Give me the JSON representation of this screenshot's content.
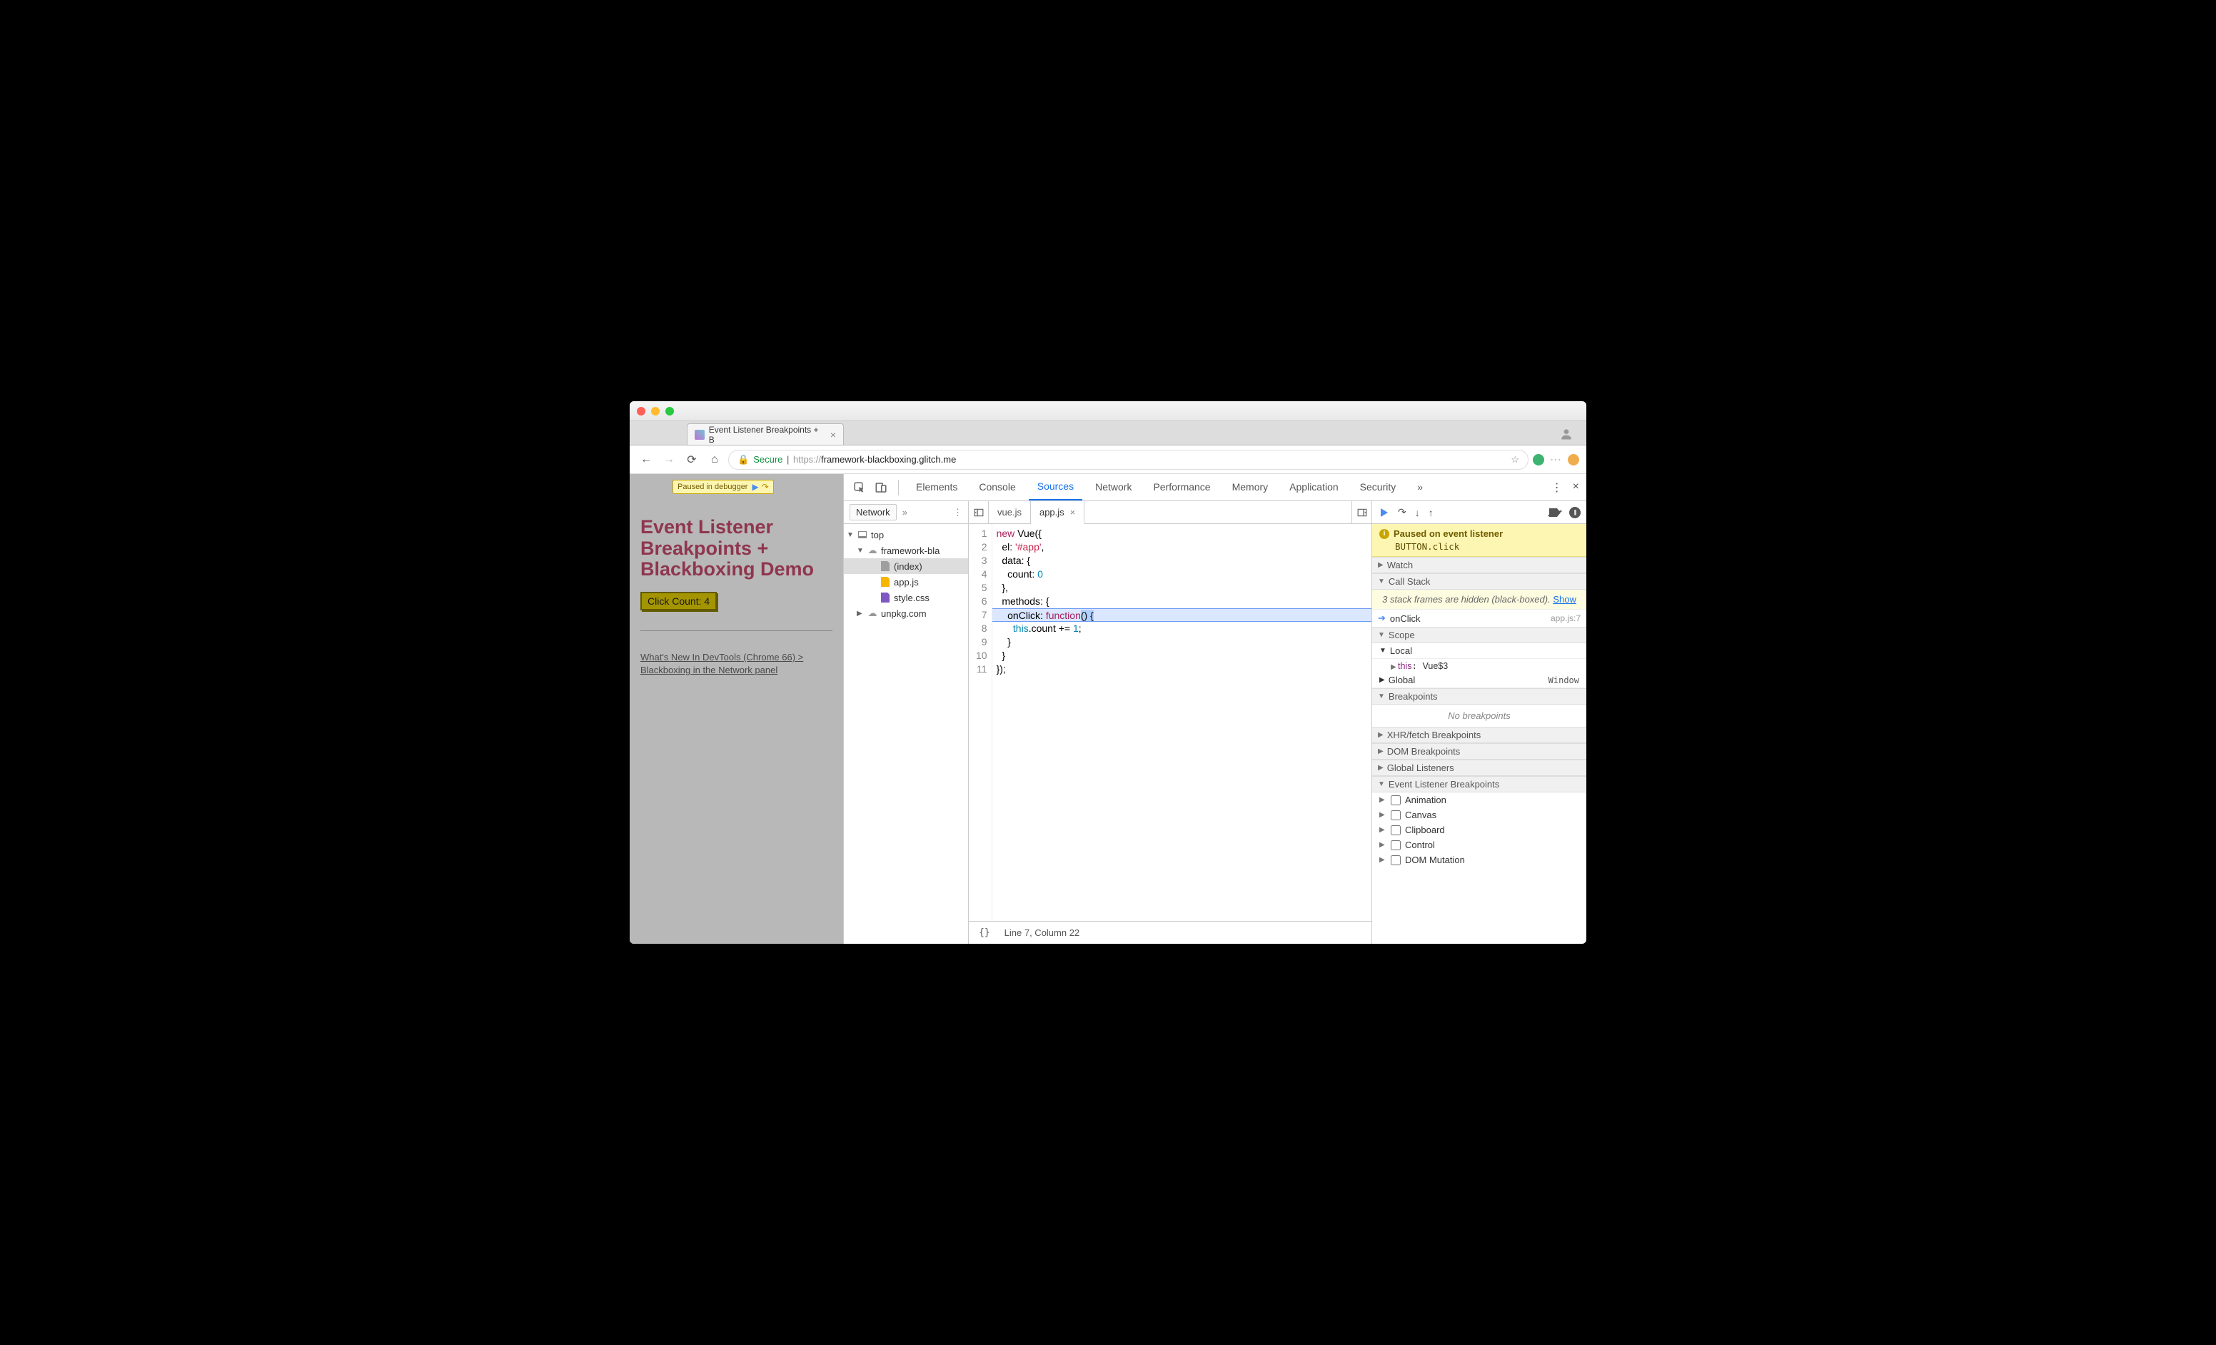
{
  "window": {},
  "browser_tab": {
    "title": "Event Listener Breakpoints + B",
    "close_x": "×"
  },
  "addr": {
    "secure_label": "Secure",
    "proto": "https://",
    "host": "framework-blackboxing.glitch.me",
    "path": ""
  },
  "page": {
    "paused_label": "Paused in debugger",
    "heading": "Event Listener Breakpoints + Blackboxing Demo",
    "button_label": "Click Count: 4",
    "link_text": "What's New In DevTools (Chrome 66) > Blackboxing in the Network panel"
  },
  "devtools": {
    "tabs": [
      "Elements",
      "Console",
      "Sources",
      "Network",
      "Performance",
      "Memory",
      "Application",
      "Security"
    ],
    "active_tab": "Sources",
    "more_icon": "»",
    "kebab": "⋮",
    "close": "×"
  },
  "filetree": {
    "tab": "Network",
    "more": "»",
    "nodes": [
      {
        "depth": 1,
        "caret": "▼",
        "icon": "frame",
        "label": "top"
      },
      {
        "depth": 2,
        "caret": "▼",
        "icon": "cloud",
        "label": "framework-bla"
      },
      {
        "depth": 3,
        "caret": "",
        "icon": "file-gray",
        "label": "(index)",
        "selected": true
      },
      {
        "depth": 3,
        "caret": "",
        "icon": "file-yellow",
        "label": "app.js"
      },
      {
        "depth": 3,
        "caret": "",
        "icon": "file-purple",
        "label": "style.css"
      },
      {
        "depth": 2,
        "caret": "▶",
        "icon": "cloud",
        "label": "unpkg.com"
      }
    ]
  },
  "editor": {
    "open_tabs": [
      {
        "name": "vue.js",
        "active": false
      },
      {
        "name": "app.js",
        "active": true
      }
    ],
    "lines": [
      {
        "n": 1,
        "html": "<span class='tok-kw'>new</span> Vue({"
      },
      {
        "n": 2,
        "html": "  el: <span class='tok-str'>'#app'</span>,"
      },
      {
        "n": 3,
        "html": "  data: {"
      },
      {
        "n": 4,
        "html": "    count: <span class='tok-num'>0</span>"
      },
      {
        "n": 5,
        "html": "  },"
      },
      {
        "n": 6,
        "html": "  methods: {"
      },
      {
        "n": 7,
        "html": "    onClick: <span class='tok-kw'>function</span><span class='exec-mark'>() {</span>",
        "exec": true
      },
      {
        "n": 8,
        "html": "      <span class='tok-this'>this</span>.count += <span class='tok-num'>1</span>;"
      },
      {
        "n": 9,
        "html": "    }"
      },
      {
        "n": 10,
        "html": "  }"
      },
      {
        "n": 11,
        "html": "});"
      }
    ],
    "status": "Line 7, Column 22"
  },
  "debugger": {
    "banner_title": "Paused on event listener",
    "banner_detail": "BUTTON.click",
    "sections": {
      "watch": "Watch",
      "callstack": "Call Stack",
      "scope": "Scope",
      "breakpoints": "Breakpoints",
      "xhr": "XHR/fetch Breakpoints",
      "dom": "DOM Breakpoints",
      "global": "Global Listeners",
      "elb": "Event Listener Breakpoints"
    },
    "blackbox_note_prefix": "3 stack frames are hidden (black-boxed).  ",
    "blackbox_show": "Show",
    "stack": [
      {
        "name": "onClick",
        "loc": "app.js:7"
      }
    ],
    "scope": {
      "local_label": "Local",
      "global_label": "Global",
      "global_val": "Window",
      "this_key": "this",
      "this_val": "Vue$3"
    },
    "breakpoints_empty": "No breakpoints",
    "elb_items": [
      "Animation",
      "Canvas",
      "Clipboard",
      "Control",
      "DOM Mutation"
    ]
  }
}
